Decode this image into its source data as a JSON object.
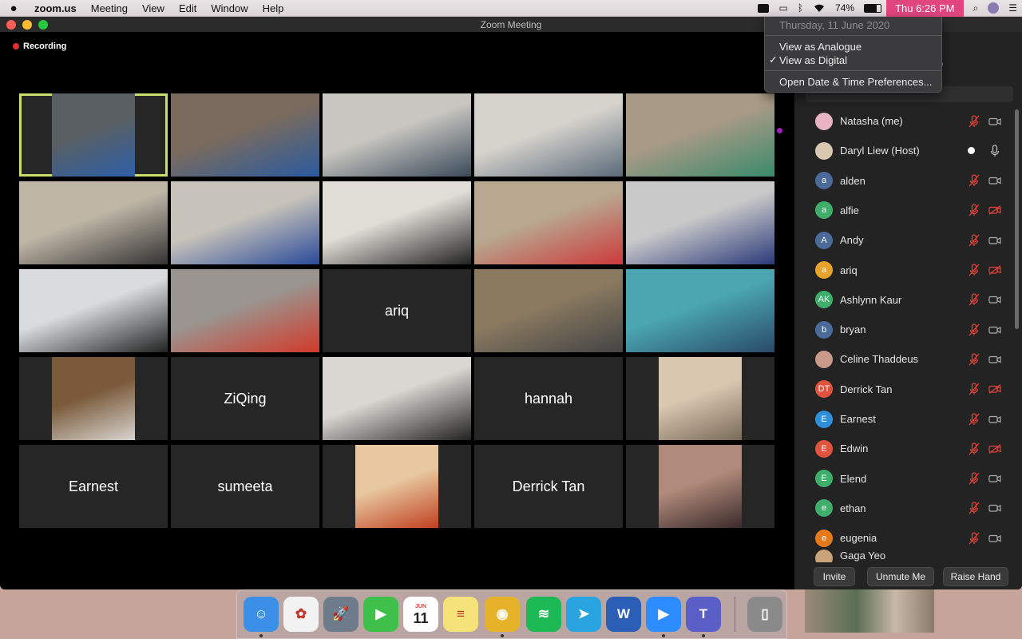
{
  "menubar": {
    "app_name": "zoom.us",
    "items": [
      "Meeting",
      "View",
      "Edit",
      "Window",
      "Help"
    ],
    "battery": "74%",
    "clock": "Thu 6:26 PM"
  },
  "window": {
    "title": "Zoom Meeting",
    "recording_label": "Recording"
  },
  "gallery": {
    "tiles": [
      {
        "type": "video",
        "active": true
      },
      {
        "type": "video"
      },
      {
        "type": "video"
      },
      {
        "type": "video"
      },
      {
        "type": "video"
      },
      {
        "type": "video"
      },
      {
        "type": "video"
      },
      {
        "type": "video"
      },
      {
        "type": "video"
      },
      {
        "type": "video"
      },
      {
        "type": "video"
      },
      {
        "type": "video"
      },
      {
        "type": "name",
        "name": "ariq"
      },
      {
        "type": "video"
      },
      {
        "type": "video"
      },
      {
        "type": "video"
      },
      {
        "type": "name",
        "name": "ZiQing"
      },
      {
        "type": "video"
      },
      {
        "type": "name",
        "name": "hannah"
      },
      {
        "type": "video"
      },
      {
        "type": "name",
        "name": "Earnest"
      },
      {
        "type": "name",
        "name": "sumeeta"
      },
      {
        "type": "video"
      },
      {
        "type": "name",
        "name": "Derrick Tan"
      },
      {
        "type": "video"
      }
    ]
  },
  "dropdown": {
    "date": "Thursday, 11 June 2020",
    "analogue": "View as Analogue",
    "digital": "View as Digital",
    "preferences": "Open Date & Time Preferences...",
    "check": "✓"
  },
  "participants_header_fragment": ")",
  "participants": [
    {
      "name": "Natasha (me)",
      "avatar": "",
      "color": "#e8b4c4",
      "mic": "muted",
      "cam": "on"
    },
    {
      "name": "Daryl Liew (Host)",
      "avatar": "",
      "color": "#d9c8b0",
      "mic": "on",
      "cam": "none",
      "dot": true
    },
    {
      "name": "alden",
      "avatar": "a",
      "color": "#4a6a9a",
      "mic": "muted",
      "cam": "on"
    },
    {
      "name": "alfie",
      "avatar": "a",
      "color": "#3fae6a",
      "mic": "muted",
      "cam": "off"
    },
    {
      "name": "Andy",
      "avatar": "A",
      "color": "#4a6a9a",
      "mic": "muted",
      "cam": "on"
    },
    {
      "name": "ariq",
      "avatar": "a",
      "color": "#e6a22a",
      "mic": "muted",
      "cam": "off"
    },
    {
      "name": "Ashlynn Kaur",
      "avatar": "AK",
      "color": "#3fae6a",
      "mic": "muted",
      "cam": "on"
    },
    {
      "name": "bryan",
      "avatar": "b",
      "color": "#4a6a9a",
      "mic": "muted",
      "cam": "on"
    },
    {
      "name": "Celine Thaddeus",
      "avatar": "",
      "color": "#c99a8a",
      "mic": "muted",
      "cam": "on"
    },
    {
      "name": "Derrick Tan",
      "avatar": "DT",
      "color": "#e0543e",
      "mic": "muted",
      "cam": "off"
    },
    {
      "name": "Earnest",
      "avatar": "E",
      "color": "#2f8fd8",
      "mic": "muted",
      "cam": "on"
    },
    {
      "name": "Edwin",
      "avatar": "E",
      "color": "#e0543e",
      "mic": "muted",
      "cam": "off"
    },
    {
      "name": "Elend",
      "avatar": "E",
      "color": "#3fae6a",
      "mic": "muted",
      "cam": "on"
    },
    {
      "name": "ethan",
      "avatar": "e",
      "color": "#3fae6a",
      "mic": "muted",
      "cam": "on"
    },
    {
      "name": "eugenia",
      "avatar": "e",
      "color": "#e67a1a",
      "mic": "muted",
      "cam": "on"
    }
  ],
  "partial_participant": "Gaga Yeo",
  "footer": {
    "invite": "Invite",
    "unmute": "Unmute Me",
    "raise_hand": "Raise Hand"
  },
  "dock": {
    "apps": [
      {
        "name": "Finder",
        "glyph": "☺",
        "color": "#3b8fe6",
        "running": true
      },
      {
        "name": "Photos",
        "glyph": "✿",
        "color": "#f2f2f2",
        "running": false
      },
      {
        "name": "Launchpad",
        "glyph": "🚀",
        "color": "#6e7b8a",
        "running": false
      },
      {
        "name": "FaceTime",
        "glyph": "▶",
        "color": "#3ec04a",
        "running": false
      },
      {
        "name": "Calendar",
        "glyph": "11",
        "color": "#ffffff",
        "running": false
      },
      {
        "name": "Notes",
        "glyph": "≡",
        "color": "#f5e37a",
        "running": false
      },
      {
        "name": "Chrome",
        "glyph": "◉",
        "color": "#e6b22a",
        "running": true
      },
      {
        "name": "Spotify",
        "glyph": "≋",
        "color": "#1db954",
        "running": false
      },
      {
        "name": "Telegram",
        "glyph": "➤",
        "color": "#2aa4e0",
        "running": false
      },
      {
        "name": "Word",
        "glyph": "W",
        "color": "#2b5fb6",
        "running": false
      },
      {
        "name": "Zoom",
        "glyph": "▶",
        "color": "#2d8cff",
        "running": true
      },
      {
        "name": "Teams",
        "glyph": "T",
        "color": "#5a5fc8",
        "running": true
      },
      {
        "name": "Trash",
        "glyph": "▯",
        "color": "#8a8a8a",
        "running": false
      }
    ],
    "calendar_month": "JUN"
  }
}
